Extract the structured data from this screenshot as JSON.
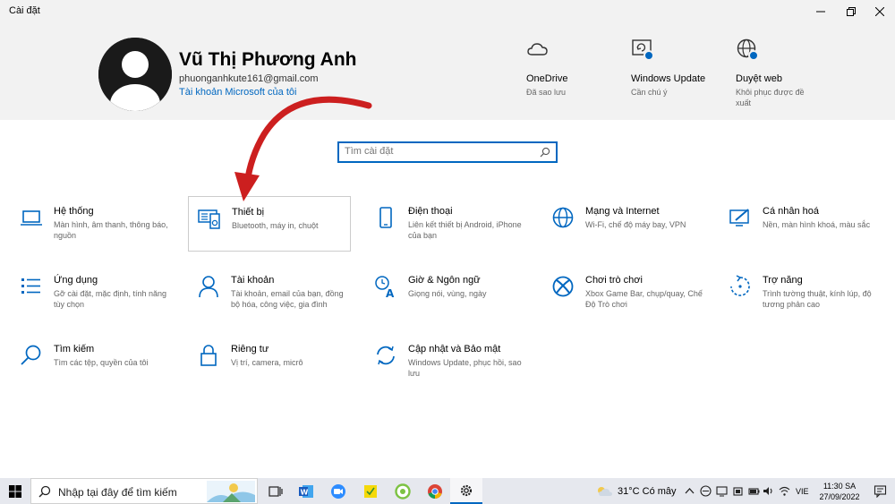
{
  "window": {
    "title": "Cài đặt"
  },
  "user": {
    "name": "Vũ Thị Phương Anh",
    "email": "phuonganhkute161@gmail.com",
    "account_link": "Tài khoản Microsoft của tôi"
  },
  "quick_links": [
    {
      "title": "OneDrive",
      "subtitle": "Đã sao lưu",
      "icon": "cloud-icon"
    },
    {
      "title": "Windows Update",
      "subtitle": "Cần chú ý",
      "icon": "windows-update-icon"
    },
    {
      "title": "Duyệt web",
      "subtitle": "Khôi phục được đề xuất",
      "icon": "globe-icon"
    }
  ],
  "search": {
    "placeholder": "Tìm cài đặt"
  },
  "settings": [
    {
      "title": "Hệ thống",
      "desc": "Màn hình, âm thanh, thông báo, nguồn",
      "icon": "laptop-icon"
    },
    {
      "title": "Thiết bị",
      "desc": "Bluetooth, máy in, chuột",
      "icon": "keyboard-speaker-icon"
    },
    {
      "title": "Điện thoại",
      "desc": "Liên kết thiết bị Android, iPhone của bạn",
      "icon": "phone-icon"
    },
    {
      "title": "Mạng và Internet",
      "desc": "Wi-Fi, chế độ máy bay, VPN",
      "icon": "globe-network-icon"
    },
    {
      "title": "Cá nhân hoá",
      "desc": "Nền, màn hình khoá, màu sắc",
      "icon": "personalization-icon"
    },
    {
      "title": "Ứng dụng",
      "desc": "Gỡ cài đặt, mặc định, tính năng tùy chọn",
      "icon": "apps-list-icon"
    },
    {
      "title": "Tài khoản",
      "desc": "Tài khoản, email của bạn, đồng bộ hóa, công việc, gia đình",
      "icon": "person-icon"
    },
    {
      "title": "Giờ & Ngôn ngữ",
      "desc": "Giọng nói, vùng, ngày",
      "icon": "time-language-icon"
    },
    {
      "title": "Chơi trò chơi",
      "desc": "Xbox Game Bar, chụp/quay, Chế Độ Trò chơi",
      "icon": "xbox-icon"
    },
    {
      "title": "Trợ năng",
      "desc": "Trình tường thuật, kính lúp, độ tương phản cao",
      "icon": "ease-of-access-icon"
    },
    {
      "title": "Tìm kiếm",
      "desc": "Tìm các tệp, quyền của tôi",
      "icon": "search-icon"
    },
    {
      "title": "Riêng tư",
      "desc": "Vị trí, camera, micrô",
      "icon": "lock-icon"
    },
    {
      "title": "Cập nhật và Bảo mật",
      "desc": "Windows Update, phục hồi, sao lưu",
      "icon": "update-sync-icon"
    }
  ],
  "taskbar": {
    "search_text": "Nhập tại đây để tìm kiếm",
    "weather": "31°C  Có mây",
    "language": "VIE",
    "time": "11:30 SA",
    "date": "27/09/2022",
    "apps": [
      "task-view-icon",
      "word-icon",
      "zoom-icon",
      "sticky-notes-icon",
      "coc-coc-icon",
      "chrome-icon",
      "settings-gear-icon"
    ]
  },
  "colors": {
    "accent": "#0067c0",
    "header_bg": "#f2f2f2",
    "annotation_arrow": "#cc1f1f"
  }
}
